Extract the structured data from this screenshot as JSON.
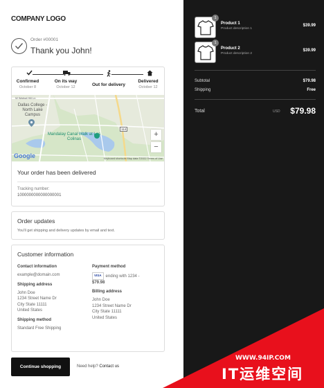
{
  "brand": {
    "logo_text": "COMPANY LOGO"
  },
  "order": {
    "number": "Order #00001",
    "thanks": "Thank you John!"
  },
  "timeline": {
    "steps": [
      {
        "label": "Confirmed",
        "date": "October 8"
      },
      {
        "label": "On its way",
        "date": "October 12"
      },
      {
        "label": "Out for delivery",
        "date": ""
      },
      {
        "label": "Delivered",
        "date": "October 12"
      }
    ]
  },
  "map": {
    "labels": [
      "W Walnut Hill Ln",
      "Dallas College - North Lake Campus",
      "Mandalay Canal Walk at Las Colinas"
    ],
    "google": "Google",
    "credits": "Keyboard shortcuts   Map data ©2022   Terms of Use",
    "zoom_in": "+",
    "zoom_out": "−",
    "road_number": "114"
  },
  "status": {
    "heading": "Your order has been delivered",
    "tracking_label": "Tracking number:",
    "tracking_value": "1000000000000000001"
  },
  "updates": {
    "title": "Order updates",
    "subtitle": "You'll get shipping and delivery updates by email and text."
  },
  "customer": {
    "title": "Customer information",
    "contact_h": "Contact information",
    "contact_v": "example@domain.com",
    "payment_h": "Payment method",
    "card_brand": "VISA",
    "payment_v": "ending with 1234 -",
    "payment_amt": "$79.98",
    "shipping_addr_h": "Shipping address",
    "shipping_addr": [
      "John Doe",
      "1234 Street Name Dr",
      "City State 11111",
      "United States"
    ],
    "billing_addr_h": "Billing address",
    "billing_addr": [
      "John Doe",
      "1234 Street Name Dr",
      "City State 11111",
      "United States"
    ],
    "shipping_method_h": "Shipping method",
    "shipping_method_v": "Standard Free Shipping"
  },
  "footer": {
    "continue_label": "Continue shopping",
    "help_text": "Need help?",
    "contact_link": "Contact us"
  },
  "summary": {
    "products": [
      {
        "name": "Product 1",
        "desc": "Product description 1",
        "price": "$39.99",
        "qty": "1"
      },
      {
        "name": "Product 2",
        "desc": "Product description 2",
        "price": "$39.99",
        "qty": "1"
      }
    ],
    "subtotal_label": "Subtotal",
    "subtotal_value": "$79.98",
    "shipping_label": "Shipping",
    "shipping_value": "Free",
    "total_label": "Total",
    "currency": "USD",
    "total_value": "$79.98"
  },
  "watermark": {
    "url": "WWW.94IP.COM",
    "name": "IT运维空间"
  },
  "colors": {
    "sidebar_bg": "#181818",
    "button_bg": "#111111",
    "watermark_red": "#e8101c"
  },
  "icons": [
    "check-icon",
    "truck-icon",
    "walking-icon",
    "home-icon",
    "map-pin-icon",
    "tshirt-icon"
  ]
}
